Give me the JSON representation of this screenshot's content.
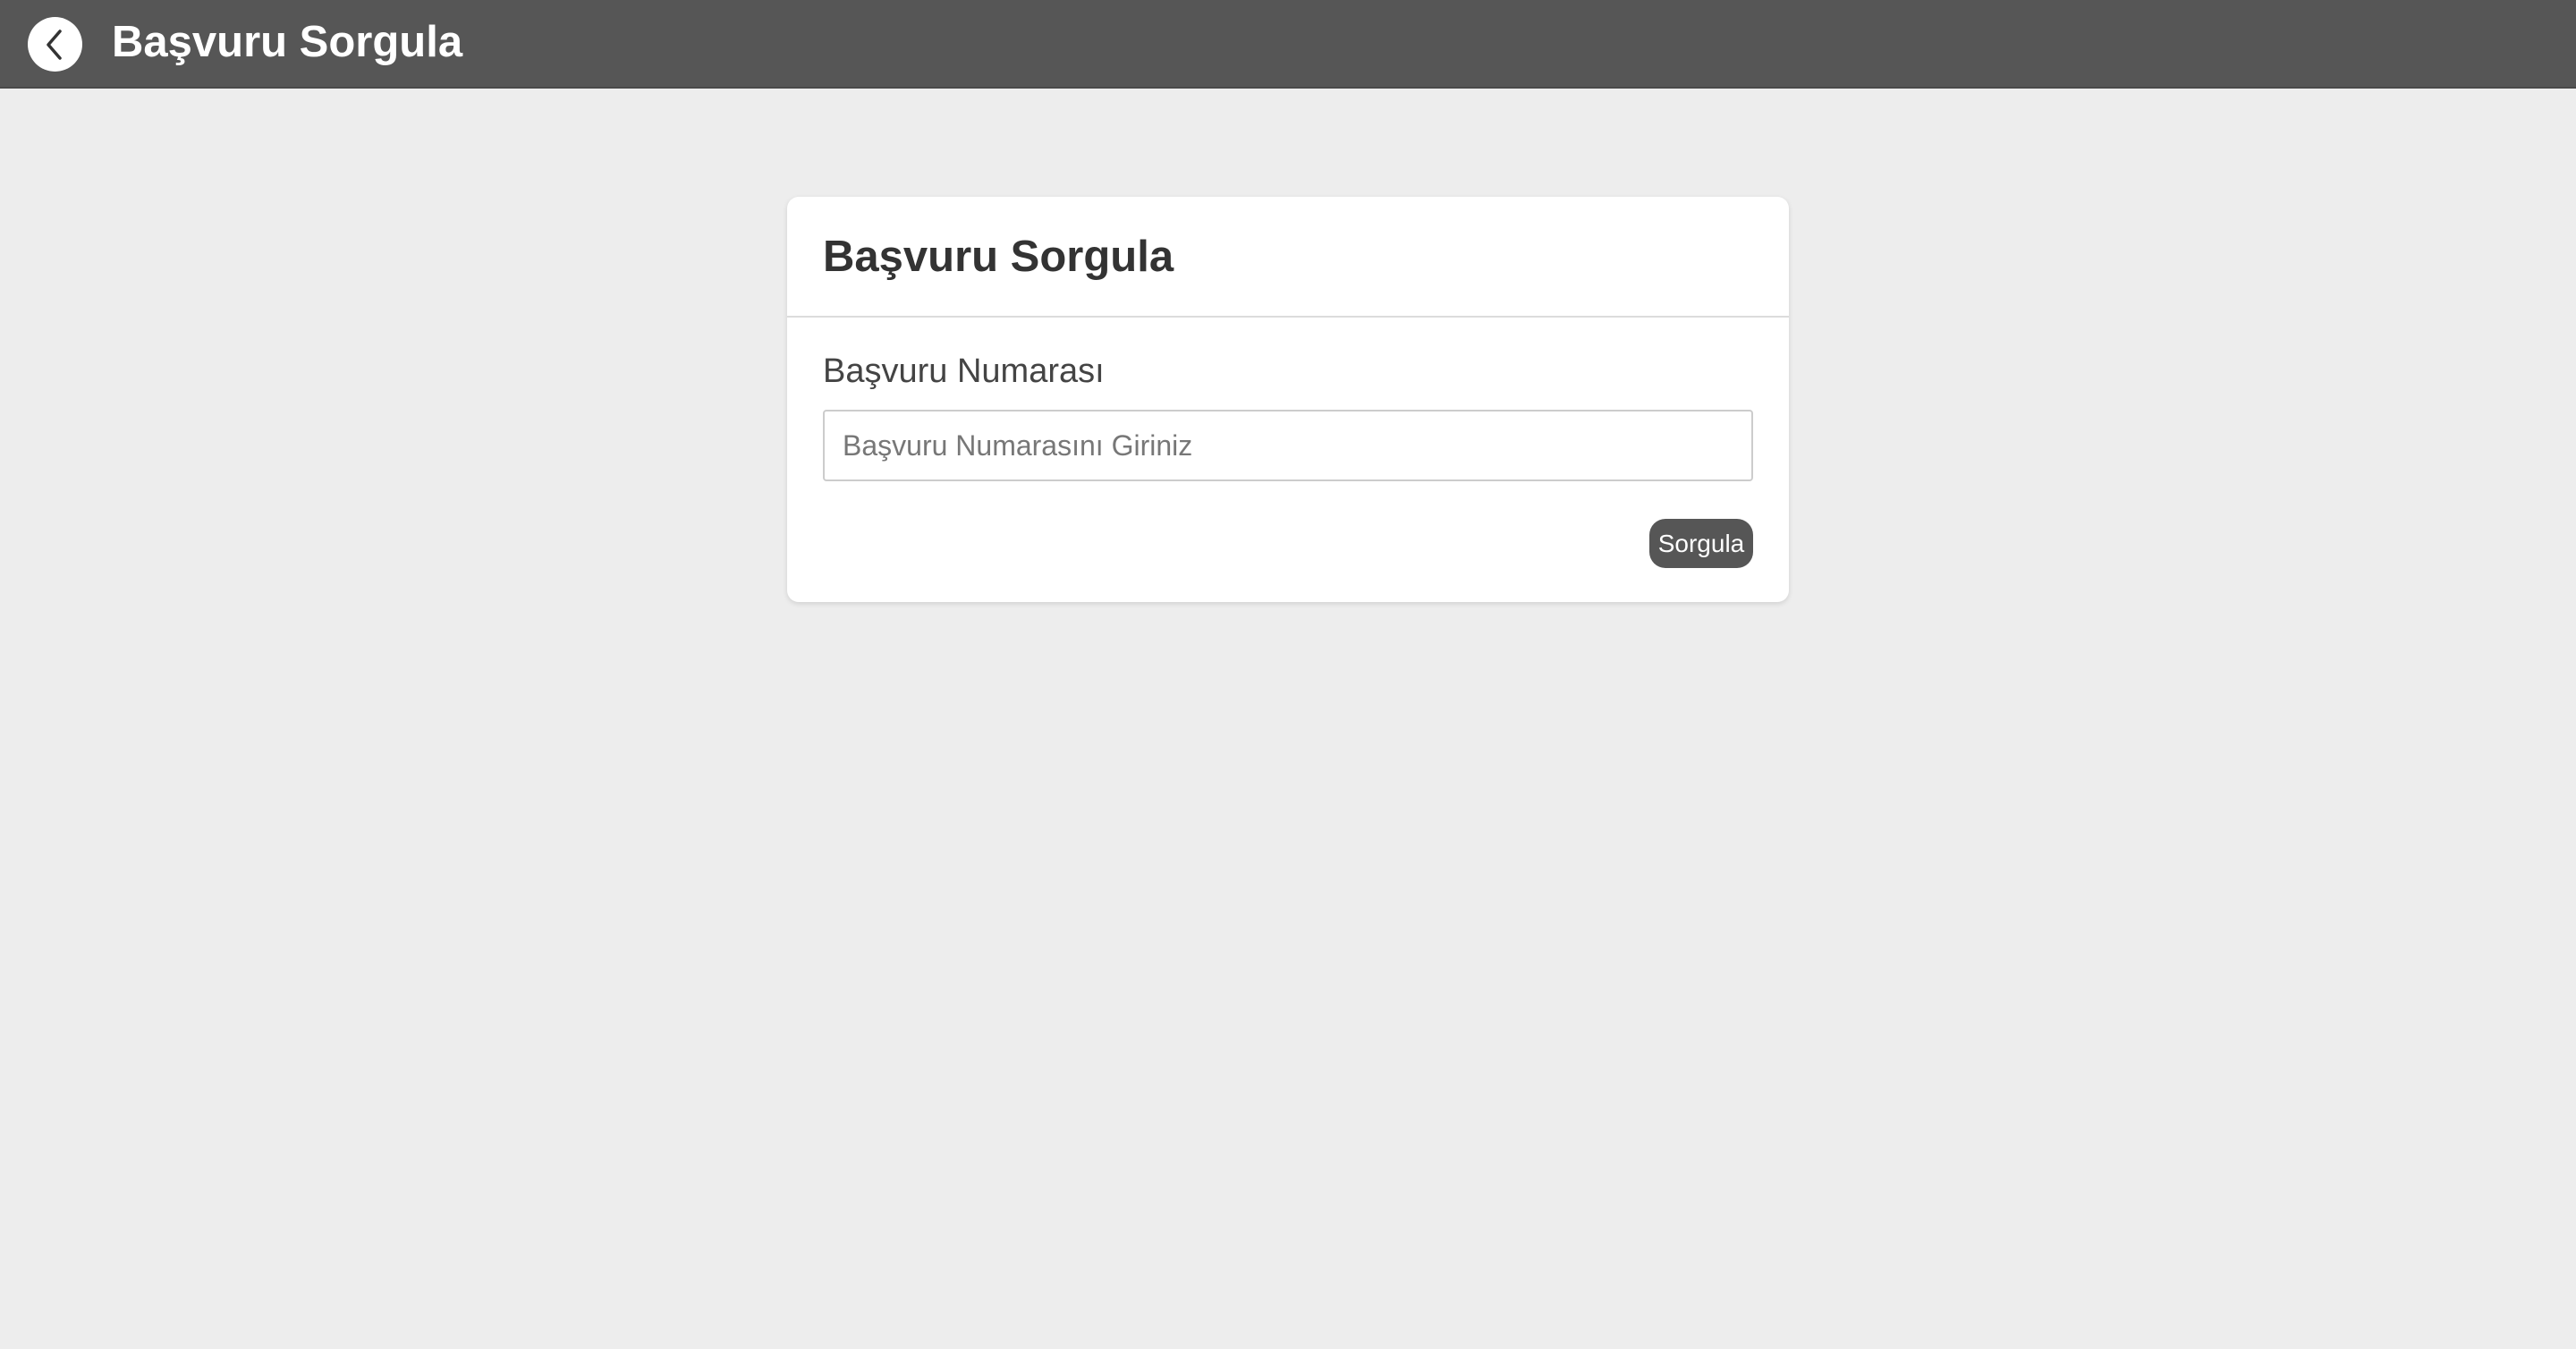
{
  "topbar": {
    "title": "Başvuru Sorgula",
    "back_icon": "chevron-left-icon"
  },
  "card": {
    "title": "Başvuru Sorgula",
    "field_label": "Başvuru Numarası",
    "input_value": "",
    "input_placeholder": "Başvuru Numarasını Giriniz",
    "submit_label": "Sorgula"
  },
  "colors": {
    "topbar_bg": "#565656",
    "page_bg": "#ededed",
    "card_bg": "#ffffff",
    "button_bg": "#565656"
  }
}
